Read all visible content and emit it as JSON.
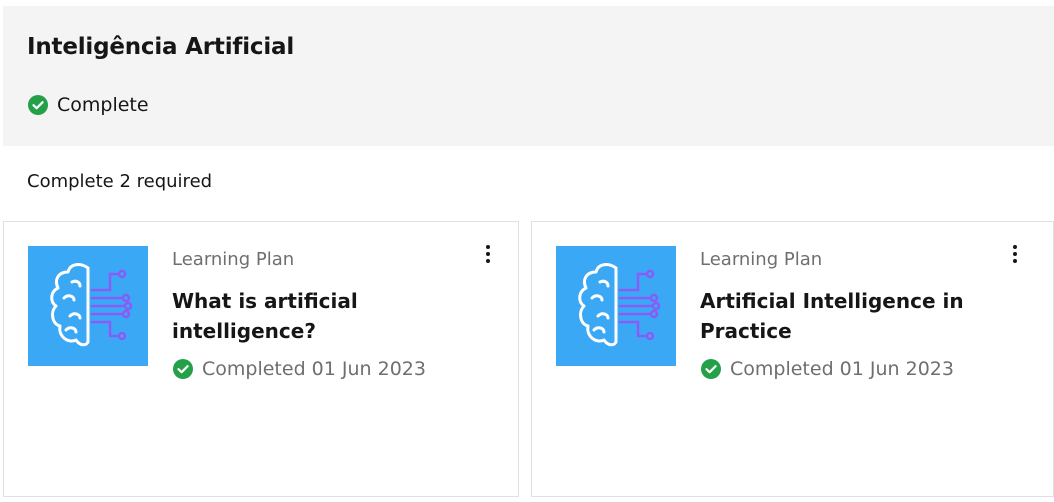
{
  "header": {
    "title": "Inteligência Artificial",
    "status_label": "Complete",
    "status_icon": "check-circle-icon",
    "status_color": "#24a148"
  },
  "requirement": "Complete 2 required",
  "cards": [
    {
      "type": "Learning Plan",
      "title": "What is artificial intelligence?",
      "status_label": "Completed 01 Jun 2023",
      "thumbnail_icon": "ai-brain-icon",
      "thumbnail_color": "#3aa8f5"
    },
    {
      "type": "Learning Plan",
      "title": "Artificial Intelligence in Practice",
      "status_label": "Completed 01 Jun 2023",
      "thumbnail_icon": "ai-brain-icon",
      "thumbnail_color": "#3aa8f5"
    }
  ]
}
